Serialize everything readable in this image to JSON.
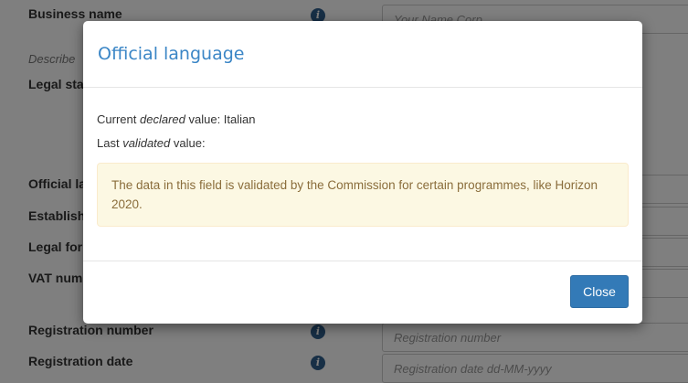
{
  "form": {
    "business_name": {
      "label": "Business name",
      "placeholder": "Your Name Corp"
    },
    "describe": {
      "text": "Describe"
    },
    "legal_status": {
      "label": "Legal status"
    },
    "official_language": {
      "label": "Official language"
    },
    "establishment": {
      "label": "Establishment"
    },
    "legal_form": {
      "label": "Legal form"
    },
    "vat_number": {
      "label": "VAT number"
    },
    "registration_number": {
      "label": "Registration number",
      "placeholder": "Registration number"
    },
    "registration_date": {
      "label": "Registration date",
      "placeholder": "Registration date dd-MM-yyyy"
    },
    "info_icon_glyph": "i"
  },
  "modal": {
    "title": "Official language",
    "current_prefix": "Current",
    "current_emph": "declared",
    "current_suffix": "value: Italian",
    "last_prefix": "Last",
    "last_emph": "validated",
    "last_suffix": "value:",
    "alert_text": "The data in this field is validated by the Commission for certain programmes, like Horizon 2020.",
    "close_label": "Close"
  }
}
